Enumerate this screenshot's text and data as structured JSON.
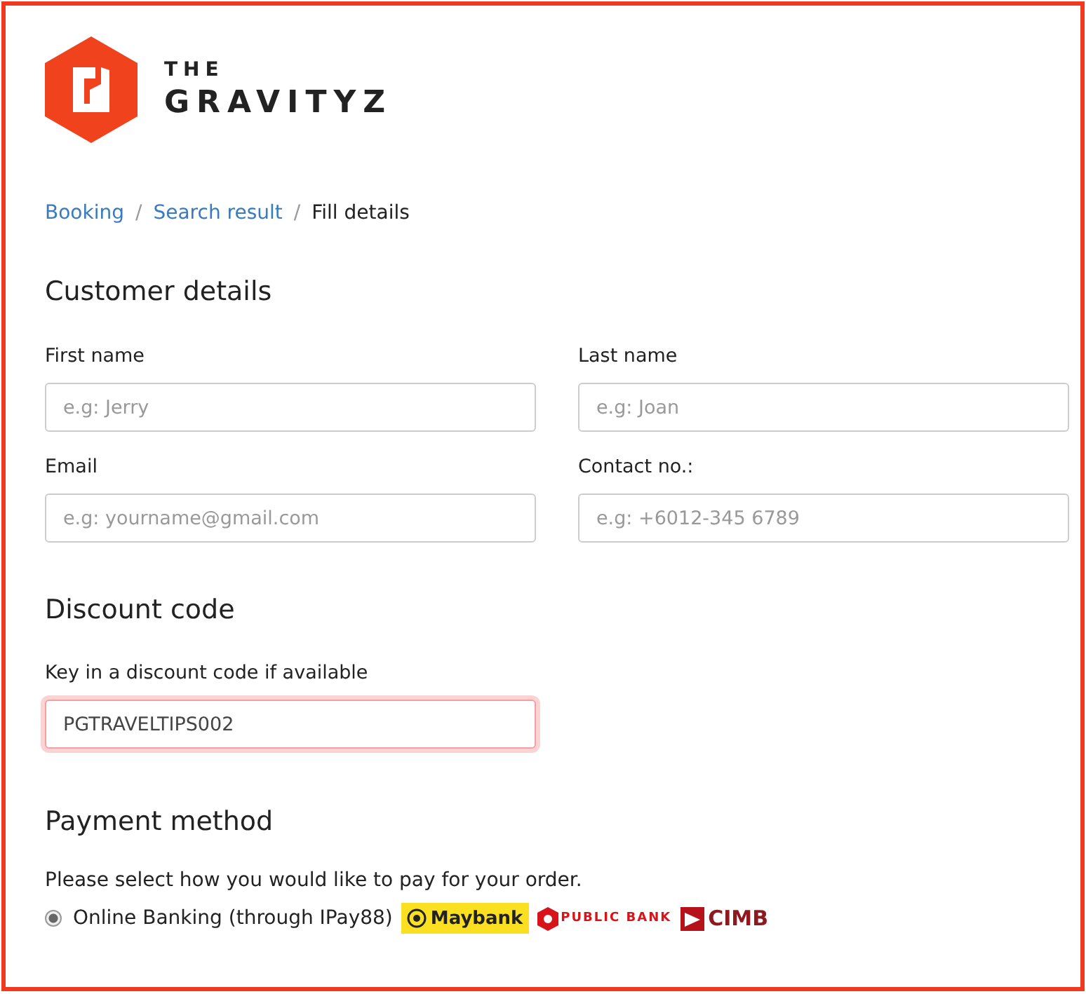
{
  "logo": {
    "line_1": "THE",
    "line_2": "GRAVITYZ"
  },
  "breadcrumb": [
    {
      "label": "Booking",
      "link": true
    },
    {
      "separator": "/",
      "label": "Search result",
      "link": true
    },
    {
      "separator": "/",
      "label": "Fill details",
      "link": false
    }
  ],
  "customer_details": {
    "title": "Customer details",
    "fields": [
      {
        "label": "First name",
        "placeholder": "e.g: Jerry"
      },
      {
        "label": "Last name",
        "placeholder": "e.g: Joan"
      },
      {
        "label": "Email",
        "placeholder": "e.g: yourname@gmail.com"
      },
      {
        "label": "Contact no.:",
        "placeholder": "e.g: +6012-345 6789"
      }
    ]
  },
  "discount": {
    "title": "Discount code",
    "label": "Key in a discount code if available",
    "value": "PGTRAVELTIPS002",
    "focused": true
  },
  "payment": {
    "title": "Payment method",
    "prompt": "Please select how you would like to pay for your order.",
    "options": [
      {
        "label": "Online Banking (through IPay88)",
        "selected": true,
        "banks": [
          {
            "kind": "maybank",
            "name": "Maybank"
          },
          {
            "kind": "publicbank",
            "name": "PUBLIC BANK"
          },
          {
            "kind": "cimb",
            "name": "CIMB"
          }
        ]
      }
    ]
  }
}
